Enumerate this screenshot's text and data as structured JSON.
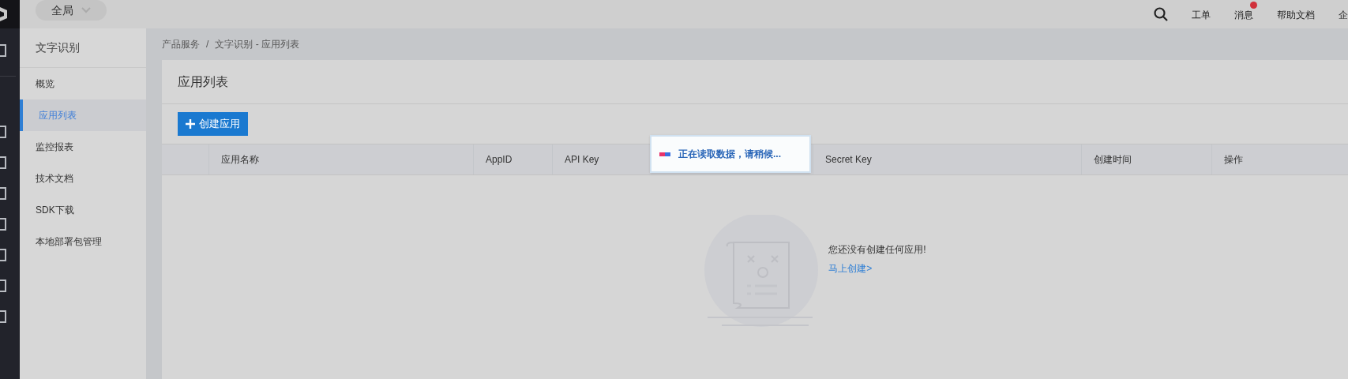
{
  "top_bar": {
    "scope_selector": "全局",
    "links": [
      {
        "label": "工单",
        "badge": false
      },
      {
        "label": "消息",
        "badge": true
      },
      {
        "label": "帮助文档",
        "badge": false
      },
      {
        "label": "企",
        "badge": false
      }
    ]
  },
  "sidebar": {
    "title": "文字识别",
    "items": [
      {
        "label": "概览",
        "selected": false
      },
      {
        "label": "应用列表",
        "selected": true
      },
      {
        "label": "监控报表",
        "selected": false
      },
      {
        "label": "技术文档",
        "selected": false
      },
      {
        "label": "SDK下载",
        "selected": false
      },
      {
        "label": "本地部署包管理",
        "selected": false
      }
    ]
  },
  "breadcrumb": [
    "产品服务",
    "文字识别 - 应用列表"
  ],
  "breadcrumb_separator": "/",
  "page_title": "应用列表",
  "create_button": "创建应用",
  "table": {
    "columns": [
      "应用名称",
      "AppID",
      "API Key",
      "Secret Key",
      "创建时间",
      "操作"
    ]
  },
  "empty_state": {
    "message": "您还没有创建任何应用!",
    "link": "马上创建>"
  },
  "loading_toast": "正在读取数据，请稍候..."
}
